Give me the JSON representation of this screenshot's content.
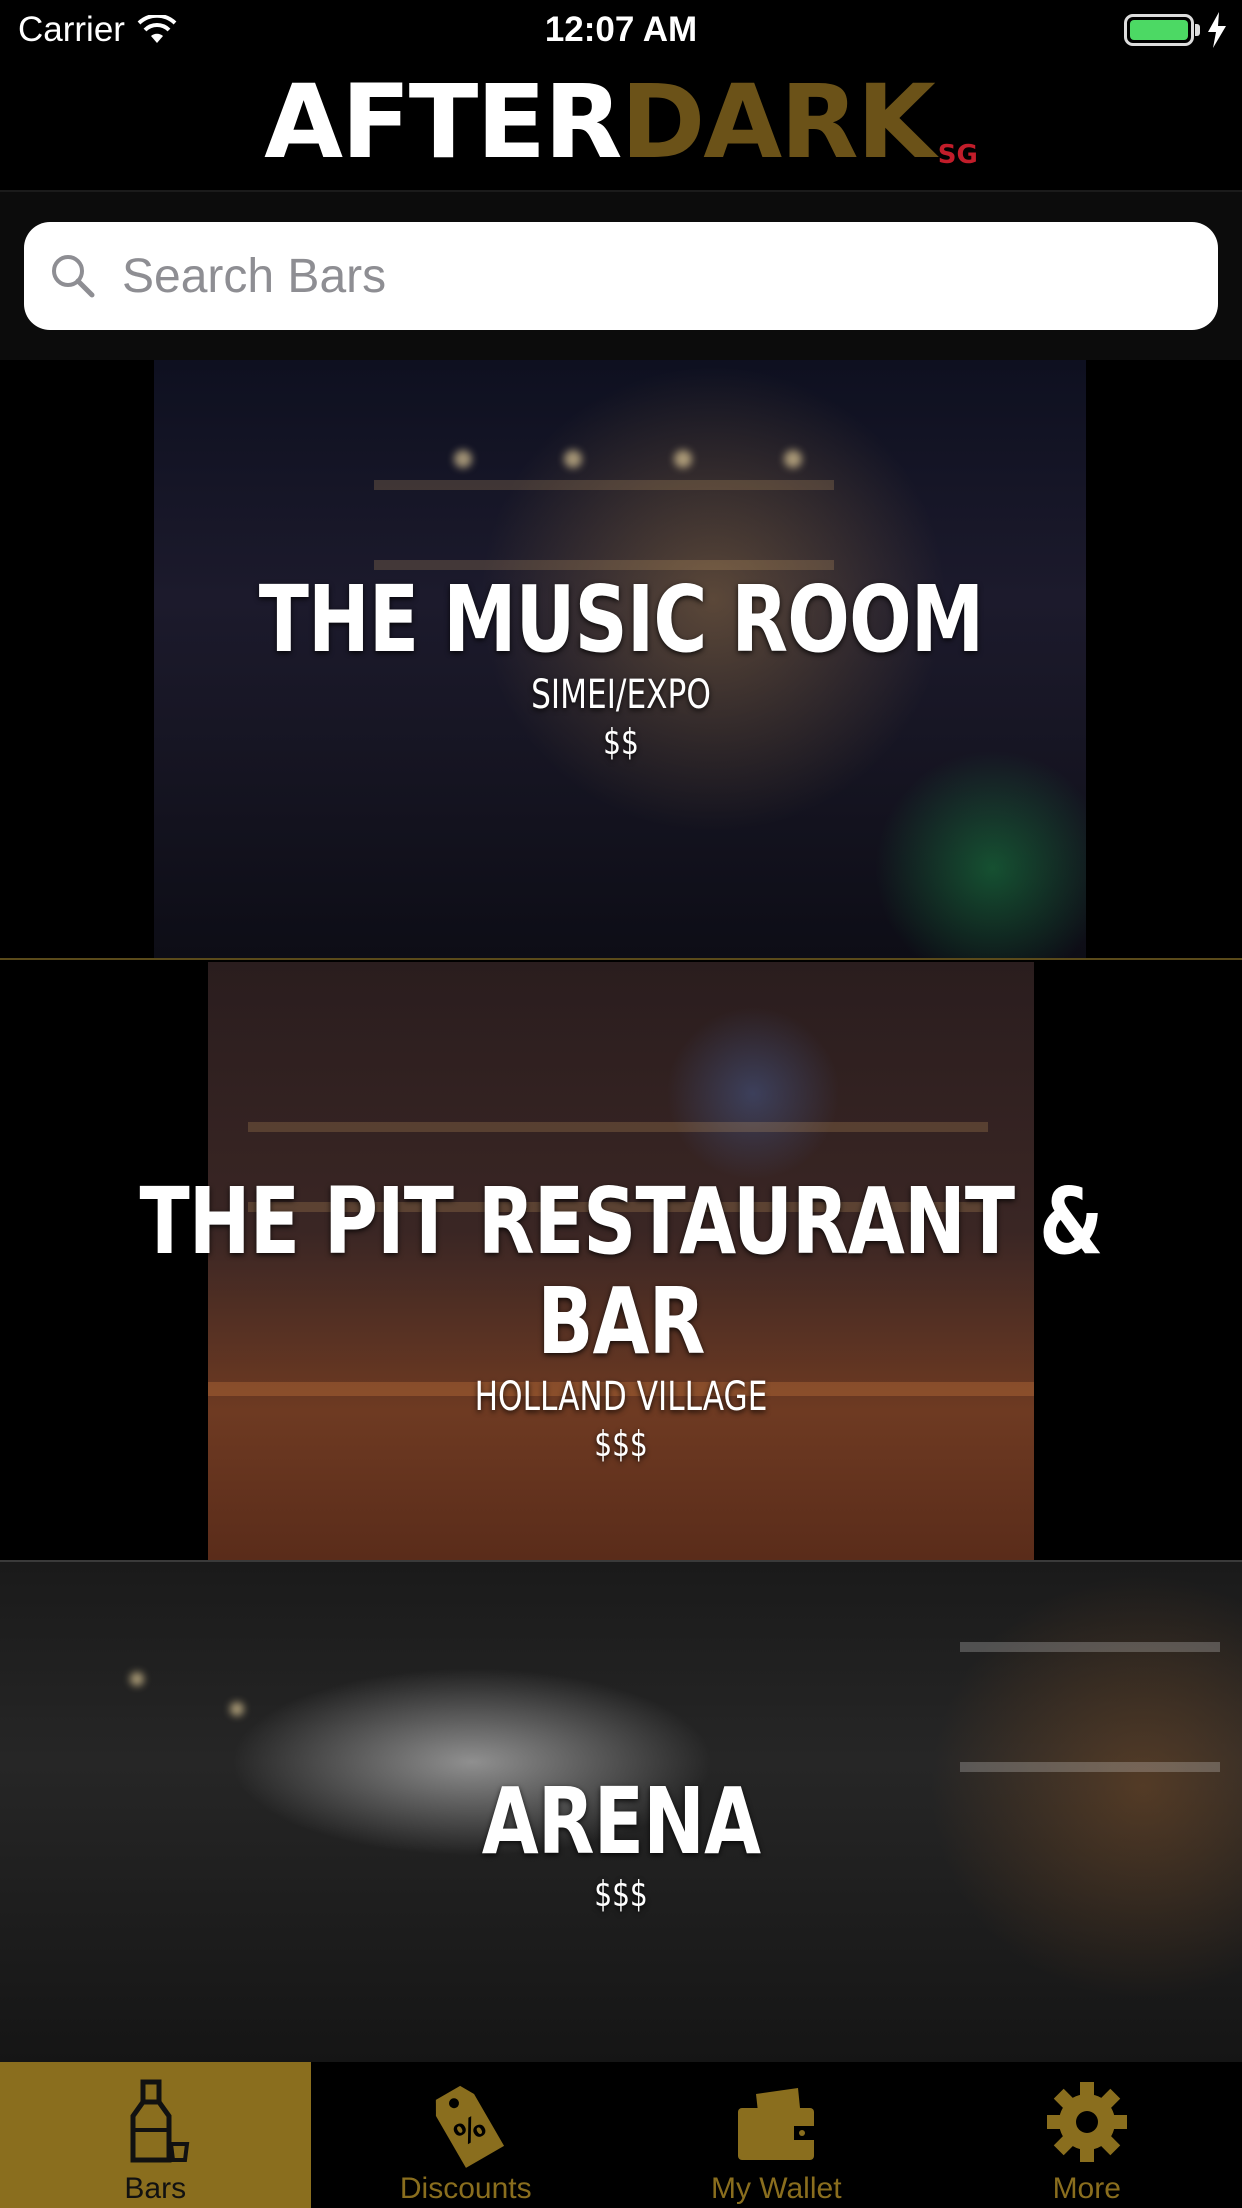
{
  "status_bar": {
    "carrier": "Carrier",
    "time": "12:07 AM",
    "battery_level": 1.0
  },
  "header": {
    "logo_part1": "AFTER",
    "logo_part2": "DARK",
    "logo_suffix": "SG"
  },
  "search": {
    "placeholder": "Search Bars",
    "value": ""
  },
  "bars": [
    {
      "name": "THE MUSIC ROOM",
      "location": "SIMEI/EXPO",
      "price": "$$"
    },
    {
      "name": "THE PIT RESTAURANT & BAR",
      "location": "HOLLAND VILLAGE",
      "price": "$$$"
    },
    {
      "name": "ARENA",
      "location": "",
      "price": "$$$"
    }
  ],
  "tabs": [
    {
      "label": "Bars",
      "icon": "bottle-icon",
      "active": true
    },
    {
      "label": "Discounts",
      "icon": "discount-tag-icon",
      "active": false
    },
    {
      "label": "My Wallet",
      "icon": "wallet-icon",
      "active": false
    },
    {
      "label": "More",
      "icon": "gear-icon",
      "active": false
    }
  ],
  "colors": {
    "accent_gold": "#8a6e1e",
    "logo_dark": "#6b5218",
    "logo_sg": "#c21d2a",
    "battery_green": "#4cd964"
  }
}
